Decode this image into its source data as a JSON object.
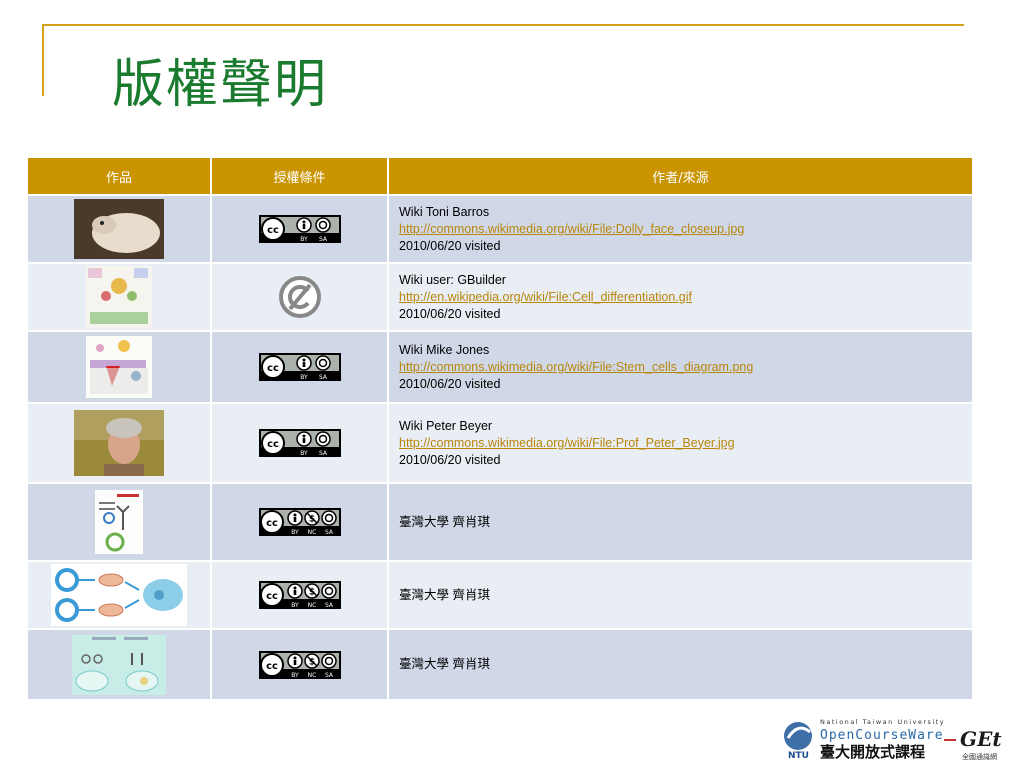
{
  "title": "版權聲明",
  "table": {
    "headers": [
      "作品",
      "授權條件",
      "作者/來源"
    ],
    "rows": [
      {
        "author": "Wiki Toni Barros",
        "url": "http://commons.wikimedia.org/wiki/File:Dolly_face_closeup.jpg",
        "visited": "2010/06/20 visited",
        "license": "by-sa"
      },
      {
        "author": "Wiki user: GBuilder",
        "url": "http://en.wikipedia.org/wiki/File:Cell_differentiation.gif",
        "visited": "2010/06/20 visited",
        "license": "public-domain"
      },
      {
        "author": "Wiki Mike Jones",
        "url": "http://commons.wikimedia.org/wiki/File:Stem_cells_diagram.png",
        "visited": "2010/06/20 visited",
        "license": "by-sa"
      },
      {
        "author": "Wiki Peter Beyer",
        "url": "http://commons.wikimedia.org/wiki/File:Prof_Peter_Beyer.jpg",
        "visited": "2010/06/20 visited",
        "license": "by-sa"
      },
      {
        "author": "臺灣大學 齊肖琪",
        "license": "by-nc-sa"
      },
      {
        "author": "臺灣大學 齊肖琪",
        "license": "by-nc-sa"
      },
      {
        "author": "臺灣大學 齊肖琪",
        "license": "by-nc-sa"
      }
    ]
  },
  "cc_labels": {
    "by": "BY",
    "sa": "SA",
    "nc": "NC",
    "cc": "cc"
  },
  "footer": {
    "ntu_line": "National Taiwan University",
    "ocw": "OpenCourseWare",
    "ocw_zh": "臺大開放式課程",
    "ntu": "NTU",
    "get": "GEt",
    "get_zh": "全國通識網"
  }
}
